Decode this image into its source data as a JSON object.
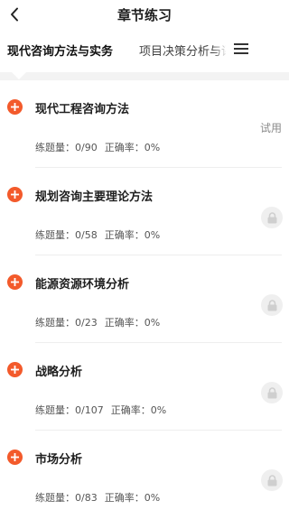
{
  "header": {
    "title": "章节练习"
  },
  "tabs": [
    {
      "label": "现代咨询方法与实务"
    },
    {
      "label": "项目决策分析与评"
    }
  ],
  "colors": {
    "accent": "#f35a2b",
    "lock_bg": "#efefef",
    "divider": "#eeeeee"
  },
  "stat_labels": {
    "questions": "练题量：",
    "accuracy": "正确率："
  },
  "chapters": [
    {
      "title": "现代工程咨询方法",
      "progress": "0/90",
      "accuracy": "0%",
      "badge": "试用",
      "locked": false
    },
    {
      "title": "规划咨询主要理论方法",
      "progress": "0/58",
      "accuracy": "0%",
      "locked": true
    },
    {
      "title": "能源资源环境分析",
      "progress": "0/23",
      "accuracy": "0%",
      "locked": true
    },
    {
      "title": "战略分析",
      "progress": "0/107",
      "accuracy": "0%",
      "locked": true
    },
    {
      "title": "市场分析",
      "progress": "0/83",
      "accuracy": "0%",
      "locked": true
    }
  ]
}
